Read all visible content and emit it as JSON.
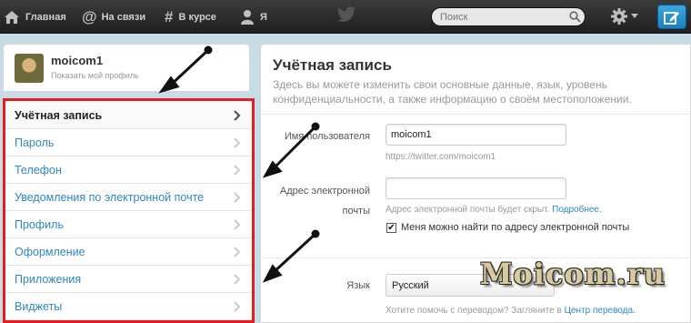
{
  "topnav": {
    "home": "Главная",
    "connect": "На связи",
    "discover": "В курсе",
    "me": "Я",
    "search_placeholder": "Поиск"
  },
  "profile": {
    "name": "moicom1",
    "show_profile": "Показать мой профиль"
  },
  "menu": {
    "items": [
      "Учётная запись",
      "Пароль",
      "Телефон",
      "Уведомления по электронной почте",
      "Профиль",
      "Оформление",
      "Приложения",
      "Виджеты"
    ]
  },
  "account": {
    "title": "Учётная запись",
    "description": "Здесь вы можете изменить свои основные данные, язык, уровень конфиденциальности, а также информацию о своём местоположении.",
    "username_label": "Имя пользователя",
    "username_value": "moicom1",
    "username_url": "https://twitter.com/moicom1",
    "email_label_1": "Адрес электронной",
    "email_label_2": "почты",
    "email_hint": "Адрес электронной почты будет скрыт.",
    "email_hint_link": "Подробнее.",
    "discover_checkbox": "Меня можно найти по адресу электронной почты",
    "language_label": "Язык",
    "language_value": "Русский",
    "translate_hint": "Хотите помочь с переводом? Загляните в",
    "translate_link": "Центр перевода."
  },
  "watermark": "Moicom.ru",
  "colors": {
    "topbar": "#2b2b2b",
    "link": "#2f86c2",
    "highlight_box": "#e61c23",
    "compose": "#2a8fd0"
  }
}
